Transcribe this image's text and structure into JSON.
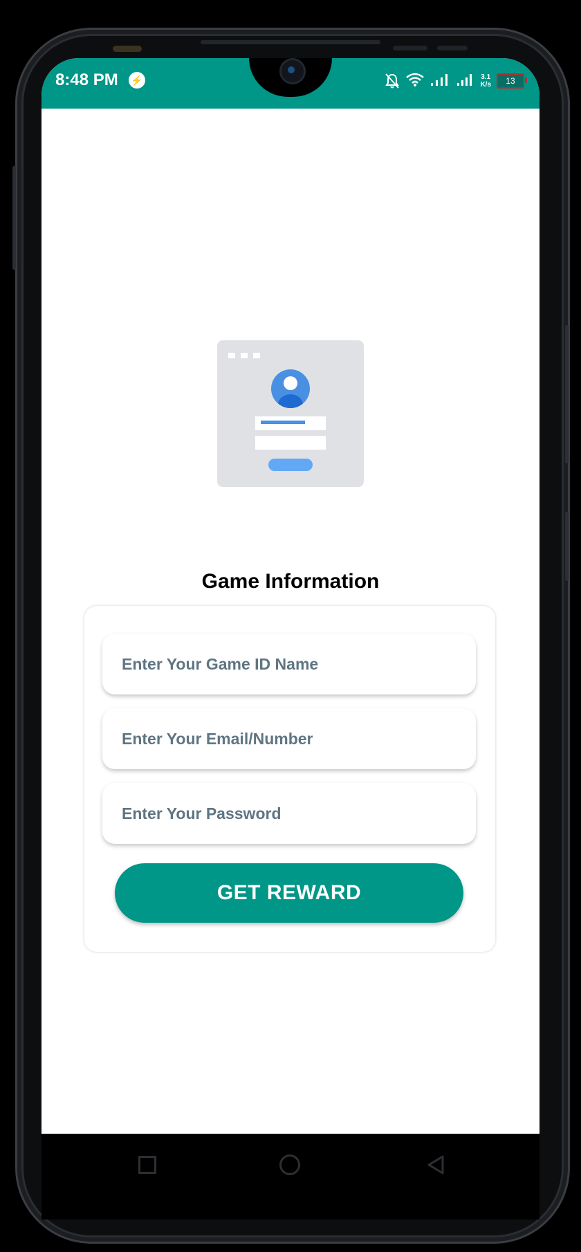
{
  "status_bar": {
    "time": "8:48 PM",
    "net_speed_value": "3.1",
    "net_speed_unit": "K/s",
    "battery_level": "13",
    "notification_icon": "messenger-icon",
    "bar_color": "#009688"
  },
  "illustration": {
    "icon": "login-card-illustration",
    "accent_color": "#4a90e2"
  },
  "form": {
    "title": "Game Information",
    "fields": [
      {
        "placeholder": "Enter Your Game ID Name"
      },
      {
        "placeholder": "Enter Your Email/Number"
      },
      {
        "placeholder": "Enter Your Password"
      }
    ],
    "submit_label": "GET REWARD",
    "button_color": "#009688"
  },
  "nav_bar": {
    "icons": [
      "recent-apps-icon",
      "home-icon",
      "back-icon"
    ]
  }
}
